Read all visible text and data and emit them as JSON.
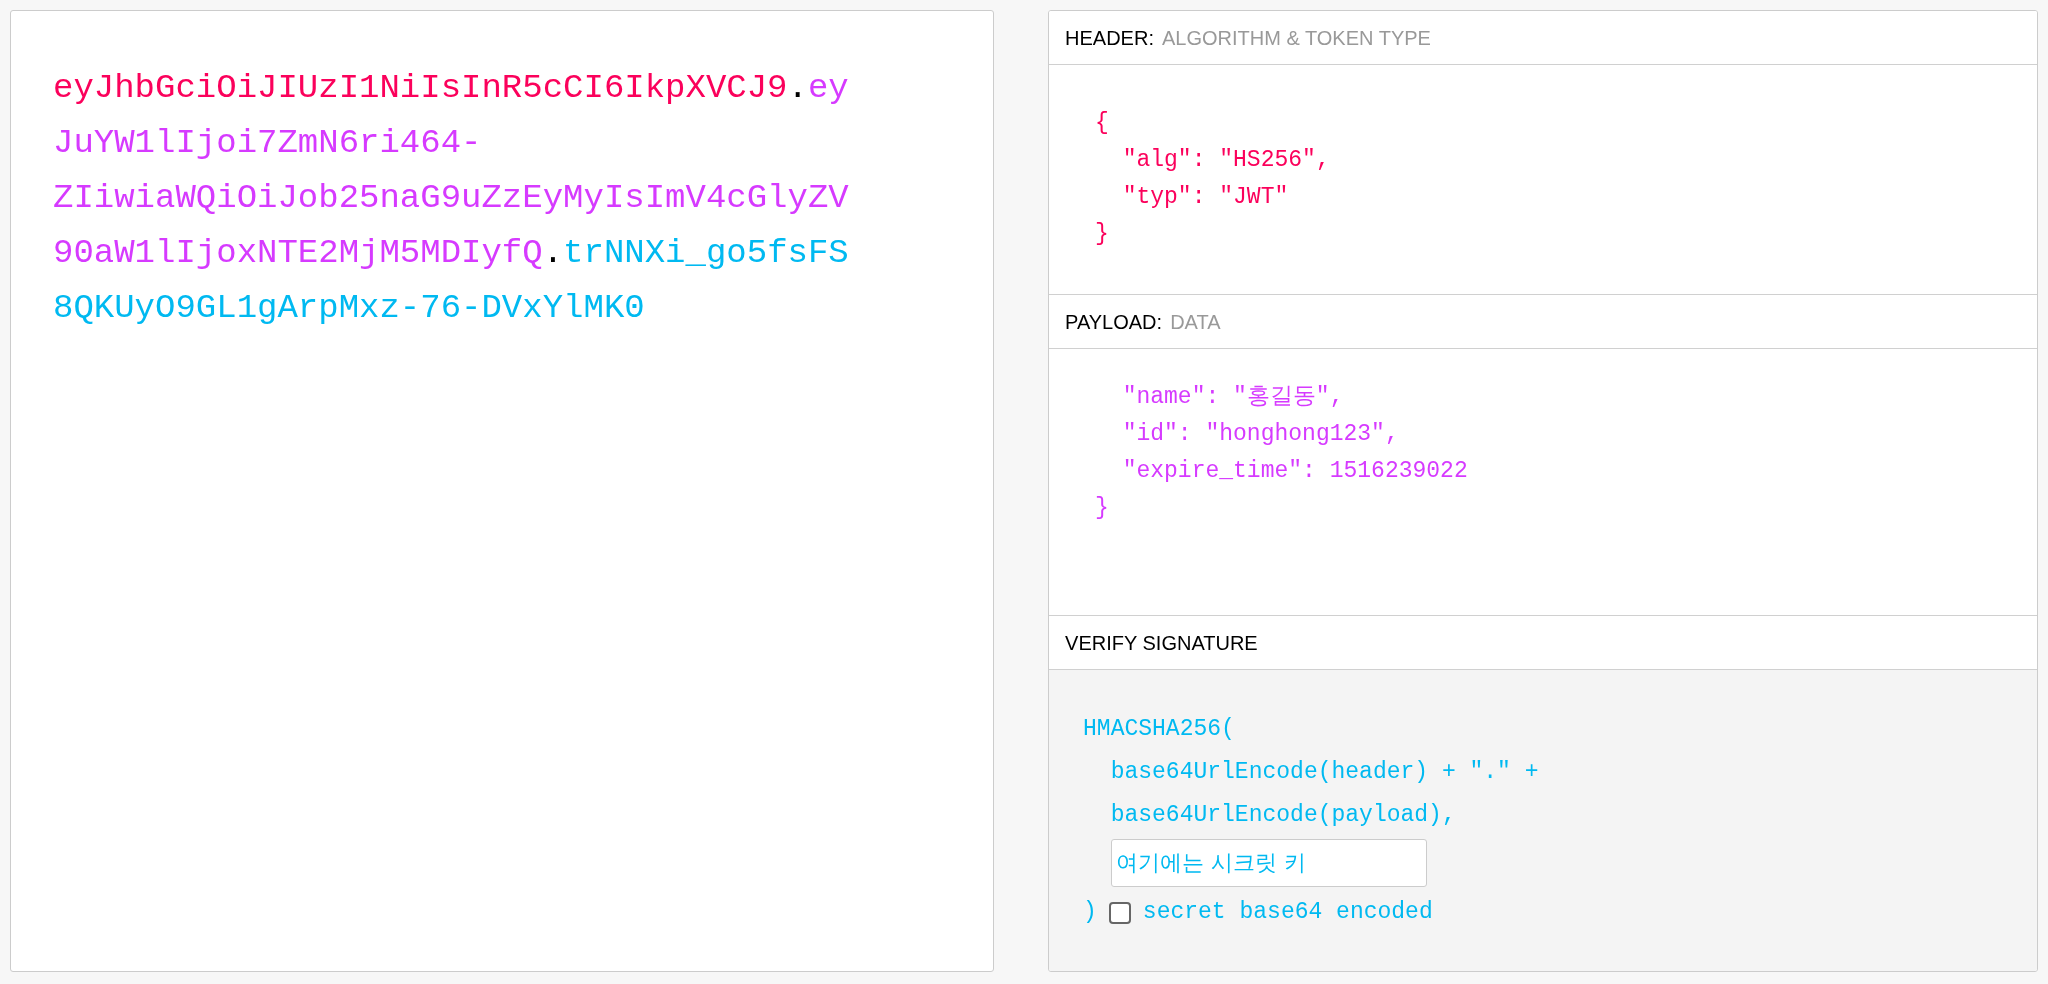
{
  "token": {
    "lines": [
      [
        {
          "kind": "header",
          "text": "eyJhbGciOiJIUzI1NiIsInR5cCI6IkpXVCJ9"
        },
        {
          "kind": "dot",
          "text": "."
        },
        {
          "kind": "payload",
          "text": "ey"
        }
      ],
      [
        {
          "kind": "payload",
          "text": "JuYW1lIjoi7ZmN6ri464-"
        }
      ],
      [
        {
          "kind": "payload",
          "text": "ZIiwiaWQiOiJob25naG9uZzEyMyIsImV4cGlyZV"
        }
      ],
      [
        {
          "kind": "payload",
          "text": "90aW1lIjoxNTE2MjM5MDIyfQ"
        },
        {
          "kind": "dot",
          "text": "."
        },
        {
          "kind": "signature",
          "text": "trNNXi_go5fsFS"
        }
      ],
      [
        {
          "kind": "signature",
          "text": "8QKUyO9GL1gArpMxz-76-DVxYlMK0"
        }
      ]
    ]
  },
  "header_panel": {
    "title": "HEADER:",
    "subtitle": "ALGORITHM & TOKEN TYPE",
    "lines": [
      "{",
      "  \"alg\": \"HS256\",",
      "  \"typ\": \"JWT\"",
      "}"
    ]
  },
  "payload_panel": {
    "title": "PAYLOAD:",
    "subtitle": "DATA",
    "lines": [
      "  \"name\": \"홍길동\",",
      "  \"id\": \"honghong123\",",
      "  \"expire_time\": 1516239022",
      "}"
    ]
  },
  "signature_panel": {
    "title": "VERIFY SIGNATURE",
    "lines": [
      "HMACSHA256(",
      "  base64UrlEncode(header) + \".\" +",
      "  base64UrlEncode(payload),"
    ],
    "secret_value": "여기에는 시크릿 키",
    "closing": ")",
    "checkbox": {
      "label": "secret base64 encoded",
      "checked": false
    }
  }
}
